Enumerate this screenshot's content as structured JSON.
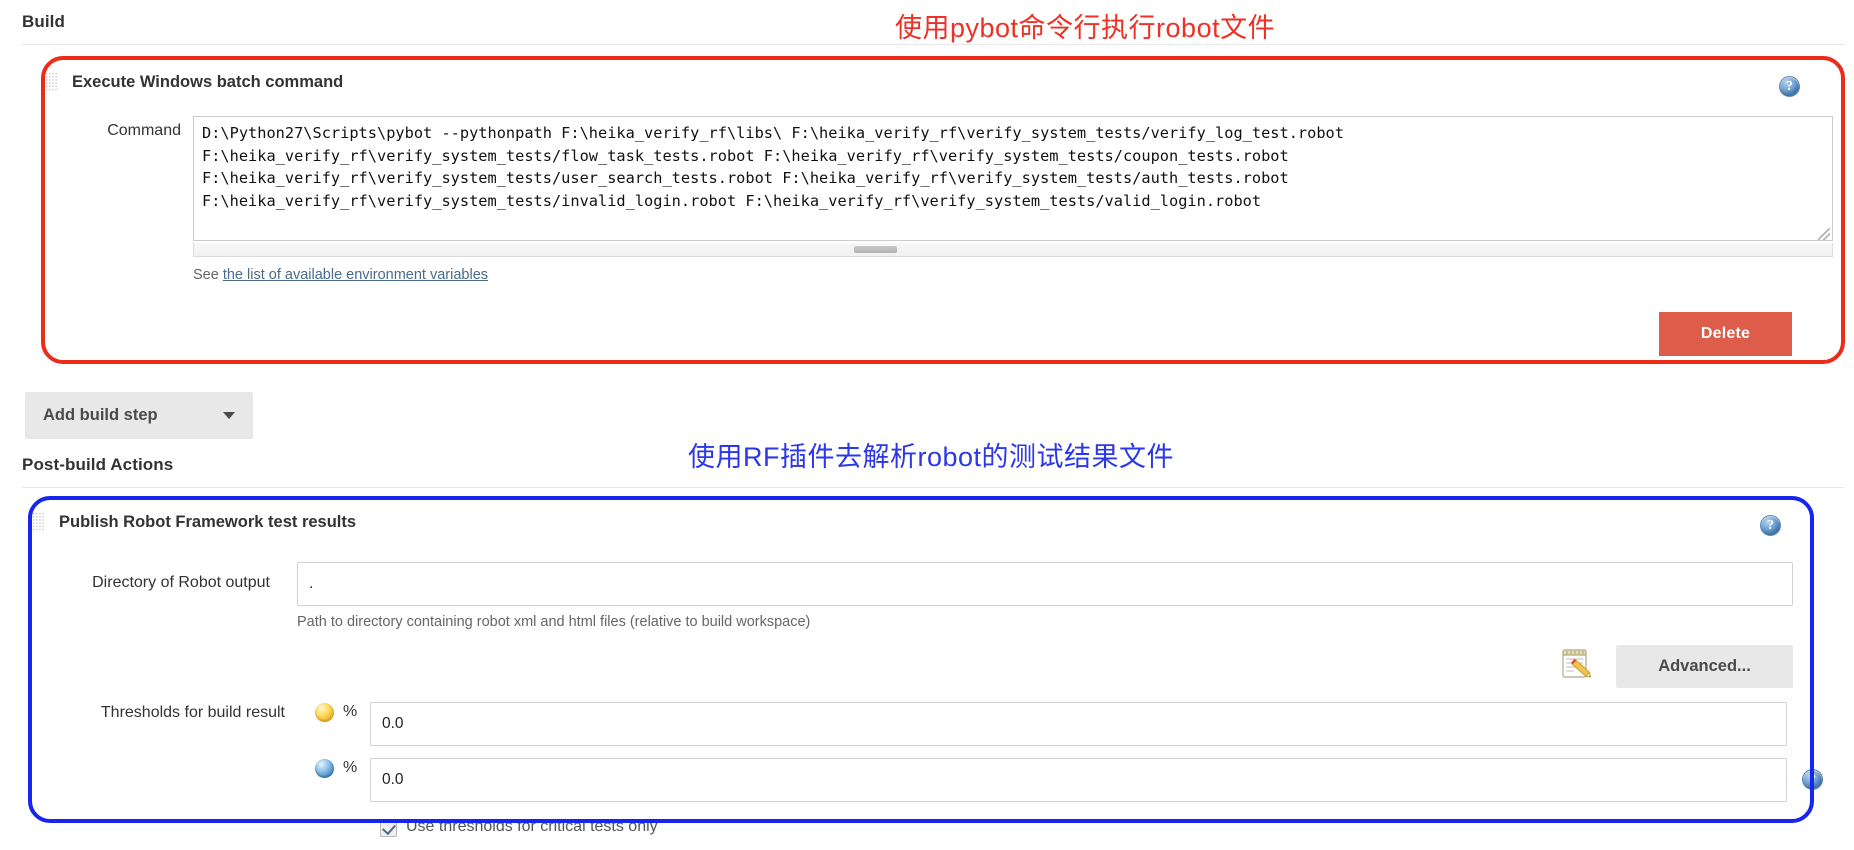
{
  "sections": {
    "build": {
      "heading": "Build"
    },
    "post_build": {
      "heading": "Post-build Actions"
    }
  },
  "annotations": {
    "red": {
      "text": "使用pybot命令行执行robot文件",
      "color": "#ee3124"
    },
    "blue": {
      "text": "使用RF插件去解析robot的测试结果文件",
      "color": "#2b37e8"
    }
  },
  "build_step": {
    "title": "Execute Windows batch command",
    "command_label": "Command",
    "command_value": "D:\\Python27\\Scripts\\pybot --pythonpath F:\\heika_verify_rf\\libs\\ F:\\heika_verify_rf\\verify_system_tests/verify_log_test.robot\nF:\\heika_verify_rf\\verify_system_tests/flow_task_tests.robot F:\\heika_verify_rf\\verify_system_tests/coupon_tests.robot\nF:\\heika_verify_rf\\verify_system_tests/user_search_tests.robot F:\\heika_verify_rf\\verify_system_tests/auth_tests.robot\nF:\\heika_verify_rf\\verify_system_tests/invalid_login.robot F:\\heika_verify_rf\\verify_system_tests/valid_login.robot",
    "env_note_prefix": "See ",
    "env_note_link": "the list of available environment variables",
    "delete_label": "Delete",
    "help_icon": "help-icon",
    "grip_icon": "drag-grip-icon"
  },
  "add_build_step": {
    "label": "Add build step",
    "caret_icon": "chevron-down-icon"
  },
  "publish_step": {
    "title": "Publish Robot Framework test results",
    "directory_label": "Directory of Robot output",
    "directory_value": ".",
    "directory_placeholder": "",
    "directory_help": "Path to directory containing robot xml and html files (relative to build workspace)",
    "advanced_label": "Advanced...",
    "advanced_icon": "notepad-pencil-icon",
    "thresholds_label": "Thresholds for build result",
    "thresholds": [
      {
        "status_icon": "unstable-yellow-ball-icon",
        "percent_sign": "%",
        "value": "0.0"
      },
      {
        "status_icon": "success-blue-ball-icon",
        "percent_sign": "%",
        "value": "0.0"
      }
    ],
    "critical_only_label": "Use thresholds for critical tests only",
    "critical_only_checked": true,
    "help_icon": "help-icon"
  }
}
